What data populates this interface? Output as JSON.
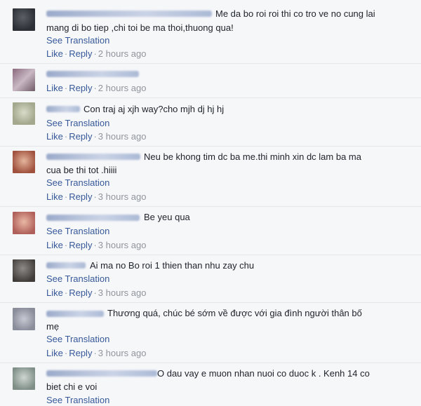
{
  "ui": {
    "see_translation": "See Translation",
    "like": "Like",
    "reply": "Reply",
    "dot": "·"
  },
  "comments": [
    {
      "line1": "Me da bo roi roi thi co tro ve no cung lai",
      "line2": "mang di bo tiep ,chi toi be ma thoi,thuong qua!",
      "time": "2 hours ago"
    },
    {
      "time": "2 hours ago"
    },
    {
      "line1": "Con traj aj xjh way?cho mjh dj hj hj",
      "time": "3 hours ago"
    },
    {
      "line1": "Neu be khong tim dc ba me.thi minh xin dc lam ba ma",
      "line2": "cua be thi tot .hiiii",
      "time": "3 hours ago"
    },
    {
      "line1": "Be yeu qua",
      "time": "3 hours ago"
    },
    {
      "line1": "Ai ma no Bo roi 1 thien than nhu zay chu",
      "time": "3 hours ago"
    },
    {
      "line1": "Thương quá, chúc bé sớm về được với gia đình người thân bố",
      "line2": "mẹ",
      "time": "3 hours ago"
    },
    {
      "line1": "O dau vay e muon nhan nuoi co duoc k . Kenh 14 co",
      "line2": "biet chi e voi"
    }
  ]
}
